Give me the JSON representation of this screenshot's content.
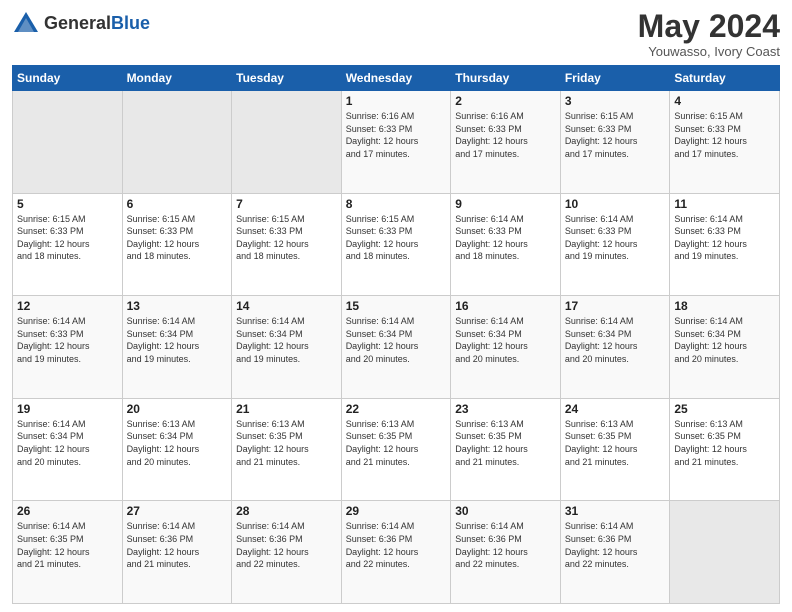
{
  "header": {
    "logo_general": "General",
    "logo_blue": "Blue",
    "month_title": "May 2024",
    "location": "Youwasso, Ivory Coast"
  },
  "weekdays": [
    "Sunday",
    "Monday",
    "Tuesday",
    "Wednesday",
    "Thursday",
    "Friday",
    "Saturday"
  ],
  "weeks": [
    [
      {
        "day": "",
        "info": ""
      },
      {
        "day": "",
        "info": ""
      },
      {
        "day": "",
        "info": ""
      },
      {
        "day": "1",
        "info": "Sunrise: 6:16 AM\nSunset: 6:33 PM\nDaylight: 12 hours\nand 17 minutes."
      },
      {
        "day": "2",
        "info": "Sunrise: 6:16 AM\nSunset: 6:33 PM\nDaylight: 12 hours\nand 17 minutes."
      },
      {
        "day": "3",
        "info": "Sunrise: 6:15 AM\nSunset: 6:33 PM\nDaylight: 12 hours\nand 17 minutes."
      },
      {
        "day": "4",
        "info": "Sunrise: 6:15 AM\nSunset: 6:33 PM\nDaylight: 12 hours\nand 17 minutes."
      }
    ],
    [
      {
        "day": "5",
        "info": "Sunrise: 6:15 AM\nSunset: 6:33 PM\nDaylight: 12 hours\nand 18 minutes."
      },
      {
        "day": "6",
        "info": "Sunrise: 6:15 AM\nSunset: 6:33 PM\nDaylight: 12 hours\nand 18 minutes."
      },
      {
        "day": "7",
        "info": "Sunrise: 6:15 AM\nSunset: 6:33 PM\nDaylight: 12 hours\nand 18 minutes."
      },
      {
        "day": "8",
        "info": "Sunrise: 6:15 AM\nSunset: 6:33 PM\nDaylight: 12 hours\nand 18 minutes."
      },
      {
        "day": "9",
        "info": "Sunrise: 6:14 AM\nSunset: 6:33 PM\nDaylight: 12 hours\nand 18 minutes."
      },
      {
        "day": "10",
        "info": "Sunrise: 6:14 AM\nSunset: 6:33 PM\nDaylight: 12 hours\nand 19 minutes."
      },
      {
        "day": "11",
        "info": "Sunrise: 6:14 AM\nSunset: 6:33 PM\nDaylight: 12 hours\nand 19 minutes."
      }
    ],
    [
      {
        "day": "12",
        "info": "Sunrise: 6:14 AM\nSunset: 6:33 PM\nDaylight: 12 hours\nand 19 minutes."
      },
      {
        "day": "13",
        "info": "Sunrise: 6:14 AM\nSunset: 6:34 PM\nDaylight: 12 hours\nand 19 minutes."
      },
      {
        "day": "14",
        "info": "Sunrise: 6:14 AM\nSunset: 6:34 PM\nDaylight: 12 hours\nand 19 minutes."
      },
      {
        "day": "15",
        "info": "Sunrise: 6:14 AM\nSunset: 6:34 PM\nDaylight: 12 hours\nand 20 minutes."
      },
      {
        "day": "16",
        "info": "Sunrise: 6:14 AM\nSunset: 6:34 PM\nDaylight: 12 hours\nand 20 minutes."
      },
      {
        "day": "17",
        "info": "Sunrise: 6:14 AM\nSunset: 6:34 PM\nDaylight: 12 hours\nand 20 minutes."
      },
      {
        "day": "18",
        "info": "Sunrise: 6:14 AM\nSunset: 6:34 PM\nDaylight: 12 hours\nand 20 minutes."
      }
    ],
    [
      {
        "day": "19",
        "info": "Sunrise: 6:14 AM\nSunset: 6:34 PM\nDaylight: 12 hours\nand 20 minutes."
      },
      {
        "day": "20",
        "info": "Sunrise: 6:13 AM\nSunset: 6:34 PM\nDaylight: 12 hours\nand 20 minutes."
      },
      {
        "day": "21",
        "info": "Sunrise: 6:13 AM\nSunset: 6:35 PM\nDaylight: 12 hours\nand 21 minutes."
      },
      {
        "day": "22",
        "info": "Sunrise: 6:13 AM\nSunset: 6:35 PM\nDaylight: 12 hours\nand 21 minutes."
      },
      {
        "day": "23",
        "info": "Sunrise: 6:13 AM\nSunset: 6:35 PM\nDaylight: 12 hours\nand 21 minutes."
      },
      {
        "day": "24",
        "info": "Sunrise: 6:13 AM\nSunset: 6:35 PM\nDaylight: 12 hours\nand 21 minutes."
      },
      {
        "day": "25",
        "info": "Sunrise: 6:13 AM\nSunset: 6:35 PM\nDaylight: 12 hours\nand 21 minutes."
      }
    ],
    [
      {
        "day": "26",
        "info": "Sunrise: 6:14 AM\nSunset: 6:35 PM\nDaylight: 12 hours\nand 21 minutes."
      },
      {
        "day": "27",
        "info": "Sunrise: 6:14 AM\nSunset: 6:36 PM\nDaylight: 12 hours\nand 21 minutes."
      },
      {
        "day": "28",
        "info": "Sunrise: 6:14 AM\nSunset: 6:36 PM\nDaylight: 12 hours\nand 22 minutes."
      },
      {
        "day": "29",
        "info": "Sunrise: 6:14 AM\nSunset: 6:36 PM\nDaylight: 12 hours\nand 22 minutes."
      },
      {
        "day": "30",
        "info": "Sunrise: 6:14 AM\nSunset: 6:36 PM\nDaylight: 12 hours\nand 22 minutes."
      },
      {
        "day": "31",
        "info": "Sunrise: 6:14 AM\nSunset: 6:36 PM\nDaylight: 12 hours\nand 22 minutes."
      },
      {
        "day": "",
        "info": ""
      }
    ]
  ]
}
